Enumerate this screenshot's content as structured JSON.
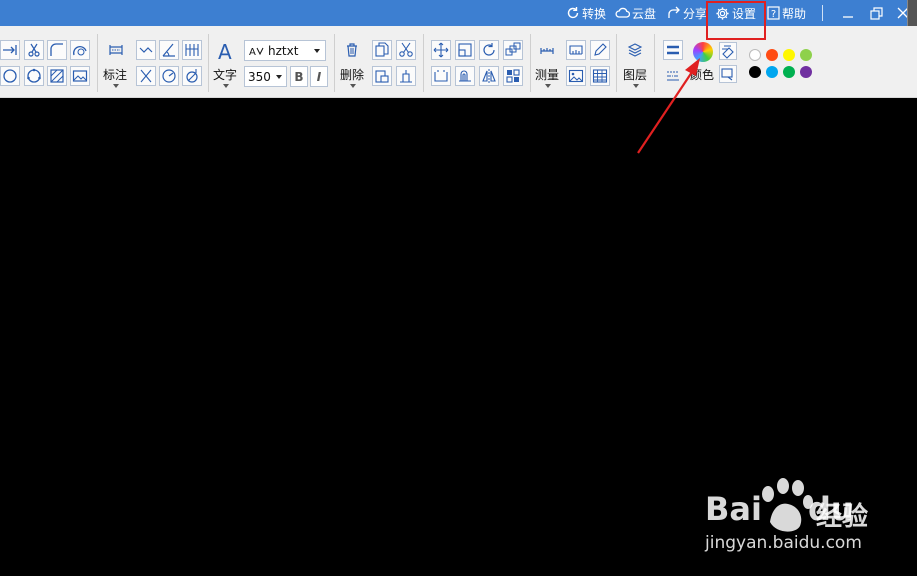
{
  "titlebar": {
    "convert": "转换",
    "cloud": "云盘",
    "share": "分享",
    "settings": "设置",
    "help": "帮助",
    "bg": "#3d7fd1"
  },
  "ribbon": {
    "dim_label": "标注",
    "text_label": "文字",
    "font_value": "hztxt",
    "size_value": "350",
    "bold": "B",
    "italic": "I",
    "delete_label": "删除",
    "measure_label": "测量",
    "layer_label": "图层",
    "color_label": "颜色"
  },
  "palette": [
    "#ffffff",
    "#ff4b13",
    "#fff700",
    "#8ed14b",
    "#000000",
    "#00a6ef",
    "#00b050",
    "#7030a0"
  ],
  "watermark": {
    "brand": "Bai",
    "brand2": "du",
    "jingyan": "经验",
    "url": "jingyan.baidu.com"
  },
  "annotation_color": "#e02020"
}
